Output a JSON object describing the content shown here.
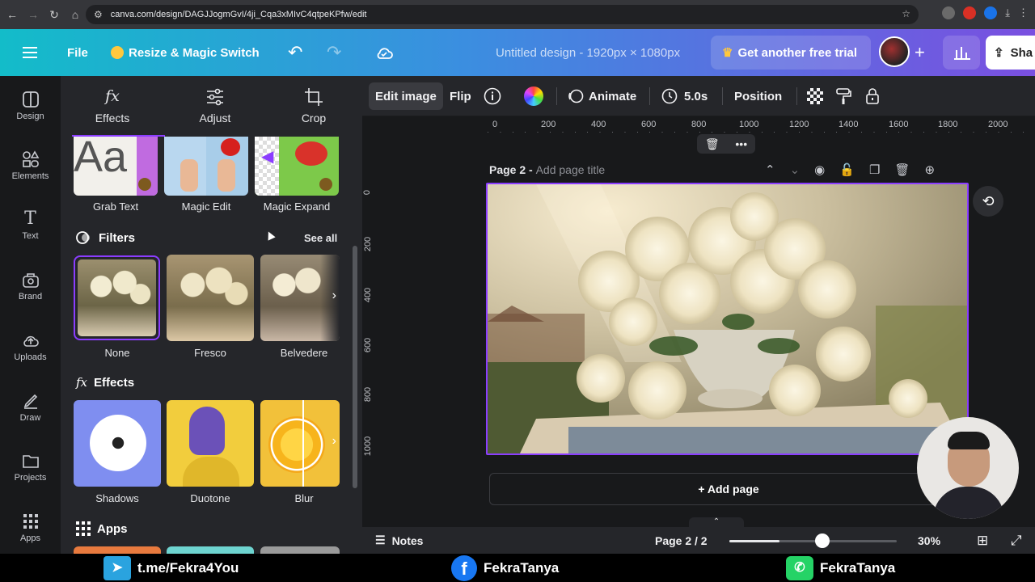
{
  "browser": {
    "url": "canva.com/design/DAGJJogmGvI/4ji_Cqa3xMIvC4qtpeKPfw/edit"
  },
  "header": {
    "file_label": "File",
    "resize_label": "Resize & Magic Switch",
    "doc_title": "Untitled design - 1920px × 1080px",
    "trial_label": "Get another free trial",
    "share_label": "Sha"
  },
  "rail": {
    "items": [
      {
        "label": "Design",
        "icon": "design-icon"
      },
      {
        "label": "Elements",
        "icon": "elements-icon"
      },
      {
        "label": "Text",
        "icon": "text-icon"
      },
      {
        "label": "Brand",
        "icon": "brand-icon"
      },
      {
        "label": "Uploads",
        "icon": "uploads-icon"
      },
      {
        "label": "Draw",
        "icon": "draw-icon"
      },
      {
        "label": "Projects",
        "icon": "projects-icon"
      },
      {
        "label": "Apps",
        "icon": "apps-icon"
      }
    ]
  },
  "panel": {
    "tabs": [
      {
        "label": "Effects",
        "icon": "fx-icon"
      },
      {
        "label": "Adjust",
        "icon": "sliders-icon"
      },
      {
        "label": "Crop",
        "icon": "crop-icon"
      }
    ],
    "tools": [
      "Grab Text",
      "Magic Edit",
      "Magic Expand"
    ],
    "filters_title": "Filters",
    "see_all": "See all",
    "filters": [
      "None",
      "Fresco",
      "Belvedere"
    ],
    "effects_title": "Effects",
    "effects": [
      "Shadows",
      "Duotone",
      "Blur"
    ],
    "apps_title": "Apps"
  },
  "toolbar": {
    "edit_image": "Edit image",
    "flip": "Flip",
    "animate": "Animate",
    "duration": "5.0s",
    "position": "Position"
  },
  "canvas": {
    "ruler_h": [
      "0",
      "200",
      "400",
      "600",
      "800",
      "1000",
      "1200",
      "1400",
      "1600",
      "1800",
      "2000"
    ],
    "ruler_v": [
      "0",
      "200",
      "400",
      "600",
      "800",
      "1000"
    ],
    "page_label": "Page 2 -",
    "page_title_placeholder": "Add page title",
    "add_page": "+ Add page"
  },
  "bottom": {
    "notes": "Notes",
    "page_counter": "Page 2 / 2",
    "zoom": "30%",
    "zoom_level": 0.3
  },
  "footer": {
    "telegram": "t.me/Fekra4You",
    "facebook": "FekraTanya",
    "whatsapp": "FekraTanya"
  },
  "colors": {
    "accent": "#8b3dff",
    "panel_bg": "#25262a",
    "canvas_bg": "#18191b"
  }
}
